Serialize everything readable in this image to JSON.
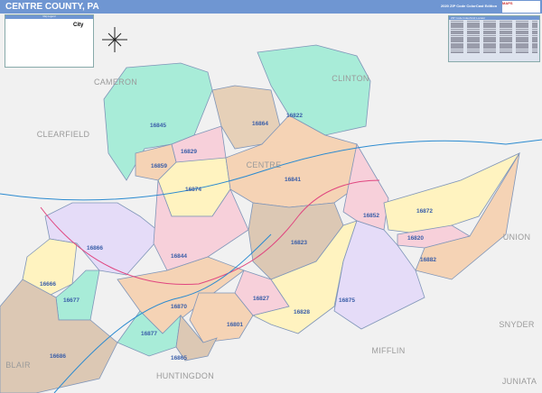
{
  "header": {
    "title": "CENTRE COUNTY, PA",
    "edition": "2020 ZIP Code ColorCast Edition",
    "logo": "MAPS"
  },
  "legend": {
    "title": "Map Legend",
    "city_label": "City"
  },
  "index": {
    "title": "ZIP Code Index/Grid Locator"
  },
  "counties": {
    "clearfield": "CLEARFIELD",
    "cameron": "CAMERON",
    "clinton": "CLINTON",
    "centre": "CENTRE",
    "union": "UNION",
    "snyder": "SNYDER",
    "mifflin": "MIFFLIN",
    "juniata": "JUNIATA",
    "huntingdon": "HUNTINGDON",
    "blair": "BLAIR"
  },
  "zips": {
    "z16822": "16822",
    "z16845": "16845",
    "z16864": "16864",
    "z16829": "16829",
    "z16859": "16859",
    "z16874": "16874",
    "z16841": "16841",
    "z16852": "16852",
    "z16872": "16872",
    "z16820": "16820",
    "z16882": "16882",
    "z16823": "16823",
    "z16866": "16866",
    "z16844": "16844",
    "z16666": "16666",
    "z16677": "16677",
    "z16870": "16870",
    "z16827": "16827",
    "z16801": "16801",
    "z16828": "16828",
    "z16875": "16875",
    "z16877": "16877",
    "z16865": "16865",
    "z16686": "16686"
  }
}
